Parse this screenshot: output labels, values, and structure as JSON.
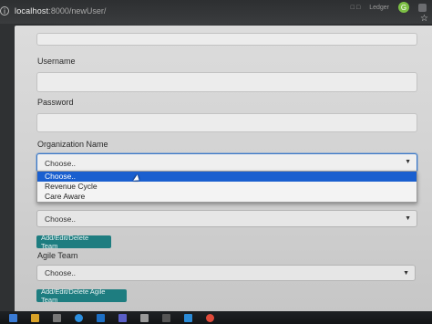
{
  "browser": {
    "host": "localhost",
    "path": ":8000/newUser/",
    "ghost_text_1": "□ □",
    "ghost_text_2": "Ledger",
    "profile_badge": "G"
  },
  "form": {
    "username_label": "Username",
    "password_label": "Password",
    "org_label": "Organization Name",
    "org_select_value": "Choose..",
    "org_options": [
      "Choose..",
      "Revenue Cycle",
      "Care Aware"
    ],
    "team_select_value": "Choose..",
    "team_button": "Add/Edit/Delete Team",
    "agile_label": "Agile Team",
    "agile_select_value": "Choose..",
    "agile_button": "Add/Edit/Delete Agile Team"
  },
  "taskbar": {
    "icons": [
      "start-icon",
      "app-icon-1",
      "app-icon-2",
      "edge-icon",
      "outlook-icon",
      "teams-icon",
      "file-icon",
      "app-icon-3",
      "vscode-icon",
      "chrome-icon"
    ]
  },
  "colors": {
    "accent_button": "#1e7d80",
    "selected_option": "#1a5fcf",
    "focus_border": "#3a78c8"
  }
}
